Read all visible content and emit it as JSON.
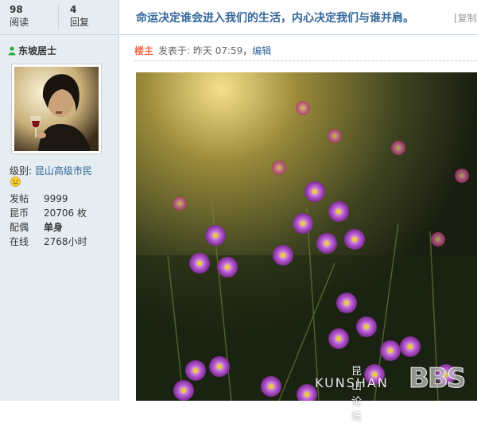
{
  "stats": {
    "views_count": "98",
    "views_label": "阅读",
    "replies_count": "4",
    "replies_label": "回复"
  },
  "author": {
    "name": "东坡居士"
  },
  "profile": {
    "level_label": "级别:",
    "level_value": "昆山高级市民",
    "rows": [
      {
        "key": "发帖",
        "value": "9999"
      },
      {
        "key": "昆币",
        "value": "20706 枚"
      },
      {
        "key": "配偶",
        "value": "单身"
      },
      {
        "key": "在线",
        "value": "2768小时"
      }
    ]
  },
  "thread": {
    "title": "命运决定谁会进入我们的生活，内心决定我们与谁并肩。",
    "copy_label": "[复制"
  },
  "post": {
    "role": "楼主",
    "posted": "发表于: 昨天 07:59",
    "separator": "，",
    "edit_label": "编辑"
  },
  "watermark": {
    "cn": "昆山论坛",
    "en": "KUNSHAN",
    "bbs": "BBS"
  },
  "colors": {
    "sidebar_bg": "#e5edf2",
    "border": "#c2d5e3",
    "link": "#336699",
    "role": "#f26c4f"
  }
}
